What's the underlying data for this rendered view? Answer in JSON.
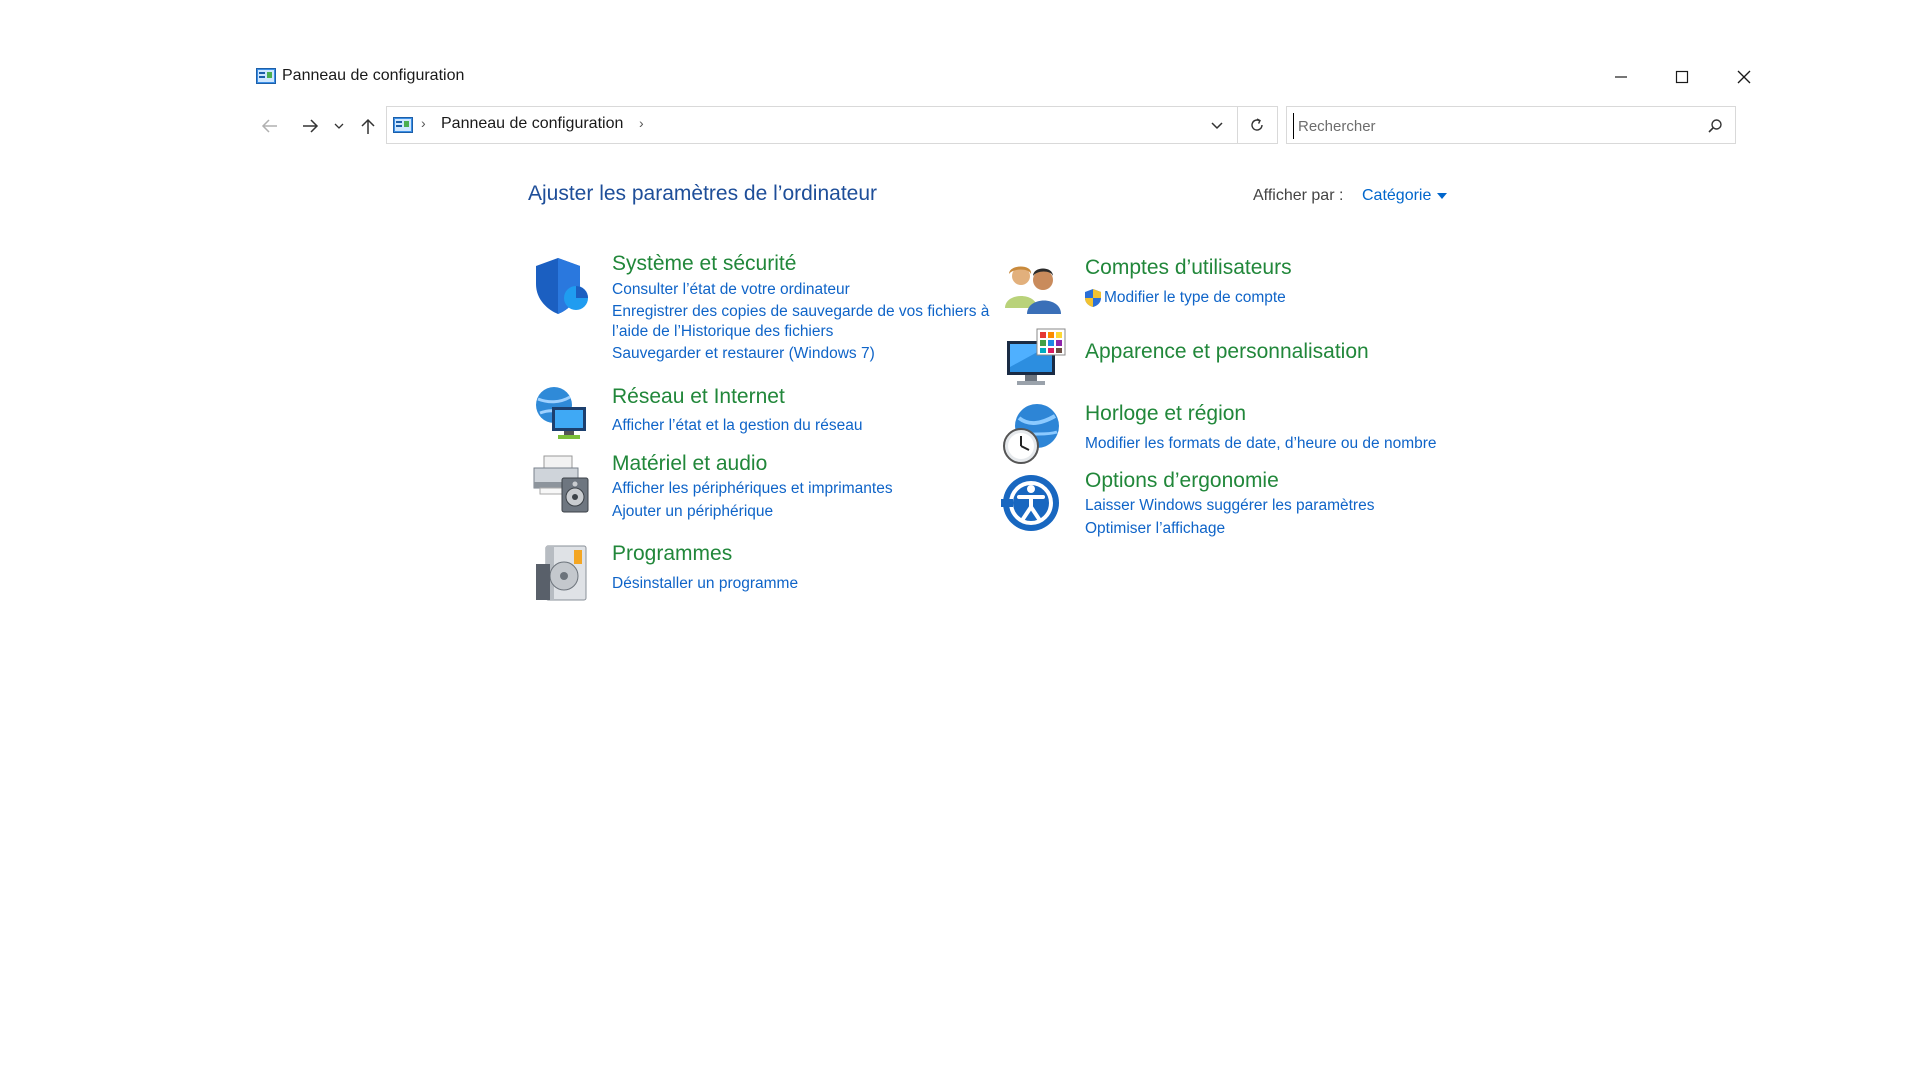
{
  "window": {
    "title": "Panneau de configuration",
    "minimize_icon": "minimize-icon",
    "maximize_icon": "maximize-icon",
    "close_icon": "close-icon"
  },
  "navigation": {
    "address_crumb": "Panneau de configuration",
    "separator": "›",
    "search_placeholder": "Rechercher",
    "search_value": ""
  },
  "header": {
    "heading": "Ajuster les paramètres de l’ordinateur",
    "view_by_label": "Afficher par :",
    "view_by_value": "Catégorie"
  },
  "categories": {
    "system": {
      "title": "Système et sécurité",
      "links": [
        "Consulter l’état de votre ordinateur",
        "Enregistrer des copies de sauvegarde de vos fichiers à l’aide de l’Historique des fichiers",
        "Sauvegarder et restaurer (Windows 7)"
      ]
    },
    "network": {
      "title": "Réseau et Internet",
      "links": [
        "Afficher l’état et la gestion du réseau"
      ]
    },
    "hardware": {
      "title": "Matériel et audio",
      "links": [
        "Afficher les périphériques et imprimantes",
        "Ajouter un périphérique"
      ]
    },
    "programs": {
      "title": "Programmes",
      "links": [
        "Désinstaller un programme"
      ]
    },
    "accounts": {
      "title": "Comptes d’utilisateurs",
      "links": [
        "Modifier le type de compte"
      ]
    },
    "appearance": {
      "title": "Apparence et personnalisation",
      "links": []
    },
    "clock": {
      "title": "Horloge et région",
      "links": [
        "Modifier les formats de date, d’heure ou de nombre"
      ]
    },
    "ease": {
      "title": "Options d’ergonomie",
      "links": [
        "Laisser Windows suggérer les paramètres",
        "Optimiser l’affichage"
      ]
    }
  },
  "colors": {
    "heading": "#1e4e99",
    "category_title": "#21873a",
    "link": "#0f64c8"
  }
}
